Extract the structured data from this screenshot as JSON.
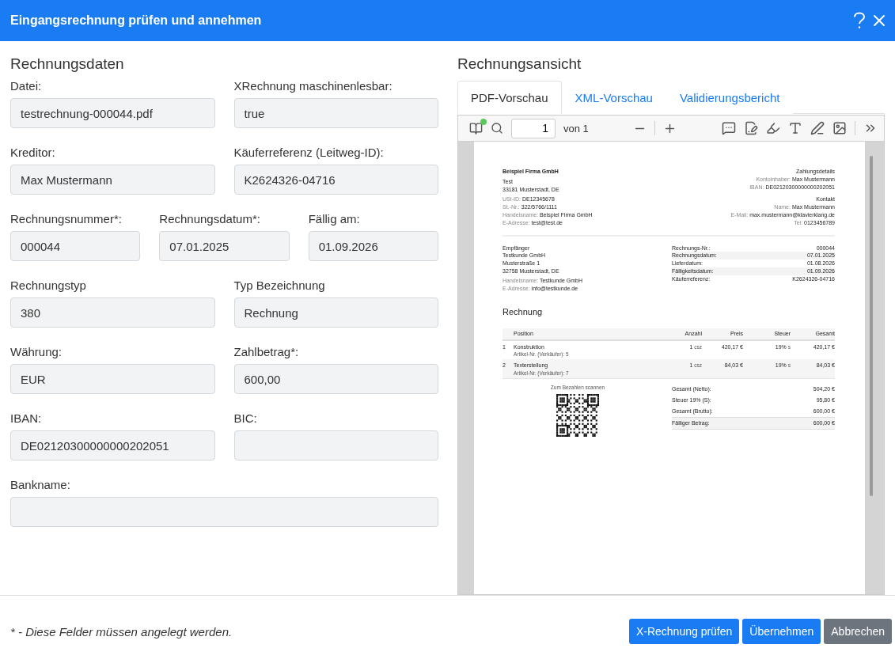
{
  "dialog": {
    "title": "Eingangsrechnung prüfen und annehmen"
  },
  "form": {
    "heading": "Rechnungsdaten",
    "rows": [
      {
        "fields": [
          {
            "label": "Datei:",
            "value": "testrechnung-000044.pdf"
          },
          {
            "label": "XRechnung maschinenlesbar:",
            "value": "true"
          }
        ]
      },
      {
        "fields": [
          {
            "label": "Kreditor:",
            "value": "Max Mustermann"
          },
          {
            "label": "Käuferreferenz (Leitweg-ID):",
            "value": "K2624326-04716"
          }
        ]
      },
      {
        "fields": [
          {
            "label": "Rechnungsnummer*:",
            "value": "000044"
          },
          {
            "label": "Rechnungsdatum*:",
            "value": "07.01.2025"
          },
          {
            "label": "Fällig am:",
            "value": "01.09.2026"
          }
        ]
      },
      {
        "fields": [
          {
            "label": "Rechnungstyp",
            "value": "380"
          },
          {
            "label": "Typ Bezeichnung",
            "value": "Rechnung"
          }
        ]
      },
      {
        "fields": [
          {
            "label": "Währung:",
            "value": "EUR"
          },
          {
            "label": "Zahlbetrag*:",
            "value": "600,00"
          }
        ]
      },
      {
        "fields": [
          {
            "label": "IBAN:",
            "value": "DE02120300000000202051"
          },
          {
            "label": "BIC:"
          }
        ]
      },
      {
        "fields": [
          {
            "label": "Bankname:"
          }
        ]
      }
    ]
  },
  "preview": {
    "heading": "Rechnungsansicht",
    "tabs": [
      {
        "label": "PDF-Vorschau",
        "selected": true
      },
      {
        "label": "XML-Vorschau",
        "selected": false
      },
      {
        "label": "Validierungsbericht",
        "selected": false
      }
    ],
    "toolbar": {
      "page": "1",
      "page_count": "von 1"
    },
    "document": {
      "seller": {
        "name": "Beispiel Firma GmbH",
        "address": [
          "Test",
          "33181 Musterstadt, DE"
        ],
        "details": [
          {
            "label": "USt-ID:",
            "value": "DE12345678"
          },
          {
            "label": "St.-Nr.:",
            "value": "322/5766/1111"
          },
          {
            "label": "Handelsname:",
            "value": "Beispiel Firma GmbH"
          },
          {
            "label": "E-Adresse:",
            "value": "test@test.de"
          }
        ]
      },
      "payment": {
        "heading": "Zahlungsdetails",
        "lines": [
          {
            "label": "Kontoinhaber:",
            "value": "Max Mustermann"
          },
          {
            "label": "IBAN:",
            "value": "DE02120300000000202051"
          }
        ]
      },
      "contact": {
        "heading": "Kontakt",
        "lines": [
          {
            "label": "Name:",
            "value": "Max Mustermann"
          },
          {
            "label": "E-Mail:",
            "value": "max.mustermann@klavierklang.de"
          },
          {
            "label": "Tel:",
            "value": "0123456789"
          }
        ]
      },
      "recipient": {
        "heading": "Empfänger",
        "address": [
          "Testkunde GmbH",
          "Musterstraße 1",
          "32758 Musterstadt, DE"
        ],
        "details": [
          {
            "label": "Handelsname:",
            "value": "Testkunde GmbH"
          },
          {
            "label": "E-Adresse:",
            "value": "info@testkunde.de"
          }
        ]
      },
      "meta": [
        {
          "label": "Rechnungs-Nr.:",
          "value": "000044"
        },
        {
          "label": "Rechnungsdatum:",
          "value": "07.01.2025"
        },
        {
          "label": "Lieferdatum:",
          "value": "01.08.2026"
        },
        {
          "label": "Fälligkeitsdatum:",
          "value": "01.09.2026"
        },
        {
          "label": "Käuferreferenz:",
          "value": "K2624326-04716"
        }
      ],
      "title": "Rechnung",
      "columns": [
        "Position",
        "Anzahl",
        "Preis",
        "Steuer",
        "Gesamt"
      ],
      "items": [
        {
          "no": "1",
          "name": "Konstruktion",
          "article": "Artikel-Nr. (Verkäufer): 5",
          "quantity": "1",
          "unit": "csz",
          "price": "420,17 €",
          "tax": "19%",
          "tax_code": "s",
          "total": "420,17 €"
        },
        {
          "no": "2",
          "name": "Texterstellung",
          "article": "Artikel-Nr. (Verkäufer): 7",
          "quantity": "1",
          "unit": "csz",
          "price": "84,03 €",
          "tax": "19%",
          "tax_code": "s",
          "total": "84,03 €"
        }
      ],
      "qr_caption": "Zum Bezahlen scannen",
      "totals": [
        {
          "label": "Gesamt (Netto):",
          "value": "504,20 €",
          "emphasis": false
        },
        {
          "label": "Steuer 19% (S):",
          "value": "95,80 €",
          "emphasis": false
        },
        {
          "label": "Gesamt (Brutto):",
          "value": "600,00 €",
          "emphasis": false
        },
        {
          "label": "Fälliger Betrag:",
          "value": "600,00 €",
          "emphasis": true
        }
      ]
    }
  },
  "footer": {
    "note": "* - Diese Felder müssen angelegt werden.",
    "buttons": [
      {
        "label": "X-Rechnung prüfen",
        "kind": "primary"
      },
      {
        "label": "Übernehmen",
        "kind": "primary"
      },
      {
        "label": "Abbrechen",
        "kind": "secondary"
      }
    ]
  }
}
